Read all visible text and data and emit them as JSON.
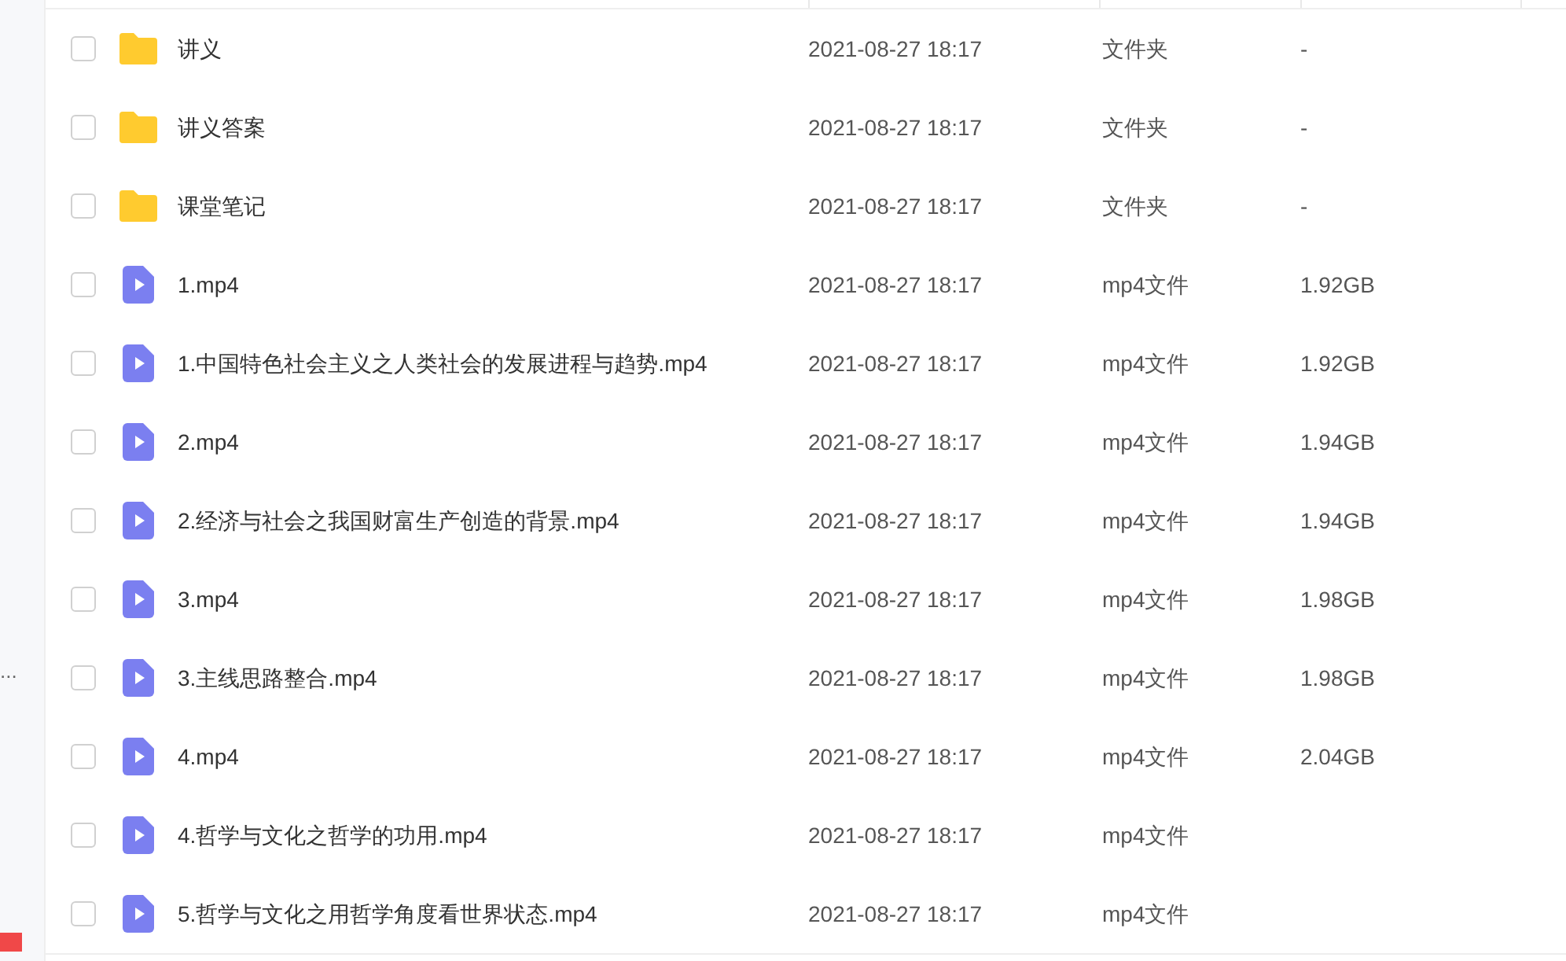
{
  "sidebar": {
    "more": "..."
  },
  "files": [
    {
      "kind": "folder",
      "name": "讲义",
      "date": "2021-08-27 18:17",
      "type": "文件夹",
      "size": "-",
      "checked": false
    },
    {
      "kind": "folder",
      "name": "讲义答案",
      "date": "2021-08-27 18:17",
      "type": "文件夹",
      "size": "-",
      "checked": false
    },
    {
      "kind": "folder",
      "name": "课堂笔记",
      "date": "2021-08-27 18:17",
      "type": "文件夹",
      "size": "-",
      "checked": false
    },
    {
      "kind": "video",
      "name": "1.mp4",
      "date": "2021-08-27 18:17",
      "type": "mp4文件",
      "size": "1.92GB",
      "checked": false
    },
    {
      "kind": "video",
      "name": "1.中国特色社会主义之人类社会的发展进程与趋势.mp4",
      "date": "2021-08-27 18:17",
      "type": "mp4文件",
      "size": "1.92GB",
      "checked": false
    },
    {
      "kind": "video",
      "name": "2.mp4",
      "date": "2021-08-27 18:17",
      "type": "mp4文件",
      "size": "1.94GB",
      "checked": false
    },
    {
      "kind": "video",
      "name": "2.经济与社会之我国财富生产创造的背景.mp4",
      "date": "2021-08-27 18:17",
      "type": "mp4文件",
      "size": "1.94GB",
      "checked": false
    },
    {
      "kind": "video",
      "name": "3.mp4",
      "date": "2021-08-27 18:17",
      "type": "mp4文件",
      "size": "1.98GB",
      "checked": false
    },
    {
      "kind": "video",
      "name": "3.主线思路整合.mp4",
      "date": "2021-08-27 18:17",
      "type": "mp4文件",
      "size": "1.98GB",
      "checked": false
    },
    {
      "kind": "video",
      "name": "4.mp4",
      "date": "2021-08-27 18:17",
      "type": "mp4文件",
      "size": "2.04GB",
      "checked": false
    },
    {
      "kind": "video",
      "name": "4.哲学与文化之哲学的功用.mp4",
      "date": "2021-08-27 18:17",
      "type": "mp4文件",
      "checked": false
    },
    {
      "kind": "video",
      "name": "5.哲学与文化之用哲学角度看世界状态.mp4",
      "date": "2021-08-27 18:17",
      "type": "mp4文件",
      "checked": false
    }
  ]
}
